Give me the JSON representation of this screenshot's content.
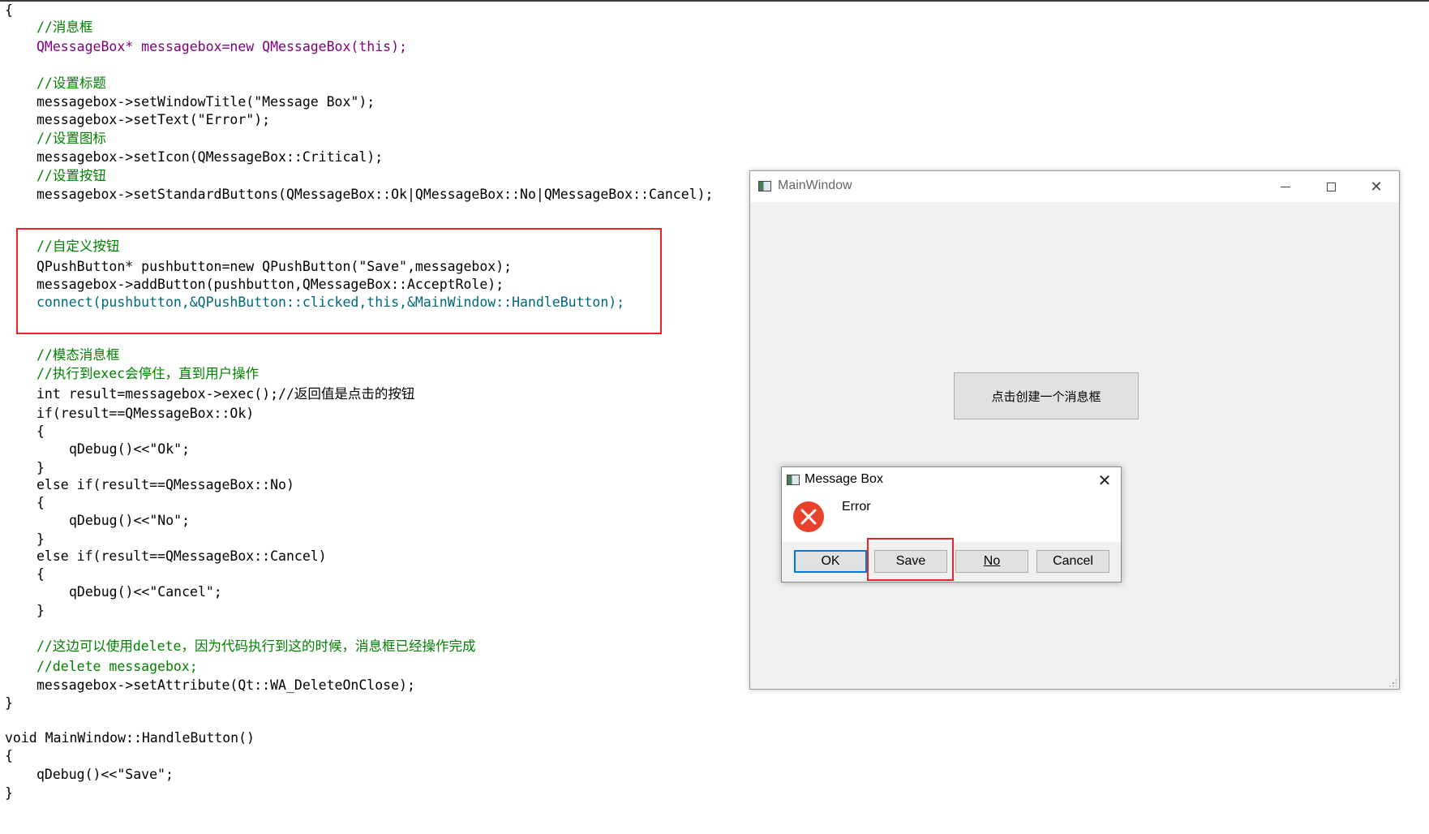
{
  "code": {
    "lines": [
      "{",
      "//消息框",
      "QMessageBox* messagebox=new QMessageBox(this);",
      "//设置标题",
      "messagebox->setWindowTitle(\"Message Box\");",
      "messagebox->setText(\"Error\");",
      "//设置图标",
      "messagebox->setIcon(QMessageBox::Critical);",
      "//设置按钮",
      "messagebox->setStandardButtons(QMessageBox::Ok|QMessageBox::No|QMessageBox::Cancel);",
      "//自定义按钮",
      "QPushButton* pushbutton=new QPushButton(\"Save\",messagebox);",
      "messagebox->addButton(pushbutton,QMessageBox::AcceptRole);",
      "connect(pushbutton,&QPushButton::clicked,this,&MainWindow::HandleButton);",
      "//模态消息框",
      "//执行到exec会停住，直到用户操作",
      "int result=messagebox->exec();//返回值是点击的按钮",
      "if(result==QMessageBox::Ok)",
      "{",
      "qDebug()<<\"Ok\";",
      "}",
      "else if(result==QMessageBox::No)",
      "{",
      "qDebug()<<\"No\";",
      "}",
      "else if(result==QMessageBox::Cancel)",
      "{",
      "qDebug()<<\"Cancel\";",
      "}",
      "//这边可以使用delete，因为代码执行到这的时候，消息框已经操作完成",
      "//delete messagebox;",
      "messagebox->setAttribute(Qt::WA_DeleteOnClose);",
      "}",
      "void MainWindow::HandleButton()",
      "{",
      "qDebug()<<\"Save\";",
      "}"
    ]
  },
  "main_window": {
    "title": "MainWindow",
    "create_button_label": "点击创建一个消息框",
    "icons": [
      "app-window-icon",
      "minimize-icon",
      "maximize-icon",
      "close-icon",
      "resize-grip-icon"
    ]
  },
  "message_box": {
    "title": "Message Box",
    "text": "Error",
    "icon": "critical-error-icon",
    "buttons": {
      "ok": "OK",
      "save": "Save",
      "no": "No",
      "cancel": "Cancel"
    }
  },
  "colors": {
    "comment": "#008000",
    "type": "#800080",
    "keyword": "#808000",
    "function": "#00677c",
    "highlight_box": "#e5252a",
    "error_icon": "#e8412c",
    "focus_border": "#0078d7"
  }
}
